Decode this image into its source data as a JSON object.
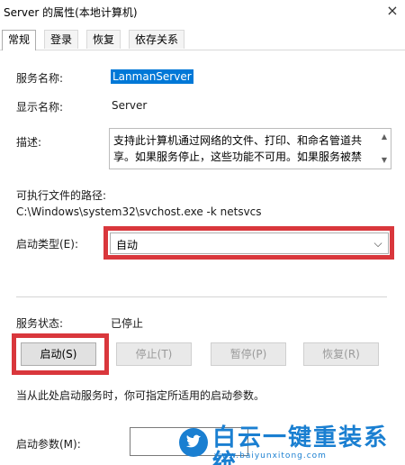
{
  "window": {
    "title": "Server 的属性(本地计算机)",
    "close_glyph": "×"
  },
  "tabs": [
    {
      "label": "常规",
      "active": true
    },
    {
      "label": "登录",
      "active": false
    },
    {
      "label": "恢复",
      "active": false
    },
    {
      "label": "依存关系",
      "active": false
    }
  ],
  "general": {
    "service_name_label": "服务名称:",
    "service_name_value": "LanmanServer",
    "display_name_label": "显示名称:",
    "display_name_value": "Server",
    "description_label": "描述:",
    "description_value": "支持此计算机通过网络的文件、打印、和命名管道共享。如果服务停止，这些功能不可用。如果服务被禁用，",
    "path_label": "可执行文件的路径:",
    "path_value": "C:\\Windows\\system32\\svchost.exe -k netsvcs",
    "startup_type_label": "启动类型(E):",
    "startup_type_value": "自动",
    "service_status_label": "服务状态:",
    "service_status_value": "已停止",
    "hint_text": "当从此处启动服务时，你可指定所适用的启动参数。",
    "start_params_label": "启动参数(M):"
  },
  "buttons": {
    "start": "启动(S)",
    "stop": "停止(T)",
    "pause": "暂停(P)",
    "resume": "恢复(R)"
  },
  "watermark": {
    "brand": "白云一键重装系统",
    "url": "www.baiyunxitong.com"
  },
  "colors": {
    "highlight": "#d9373c",
    "selection": "#0078d7",
    "watermark": "#1a7fd1"
  }
}
